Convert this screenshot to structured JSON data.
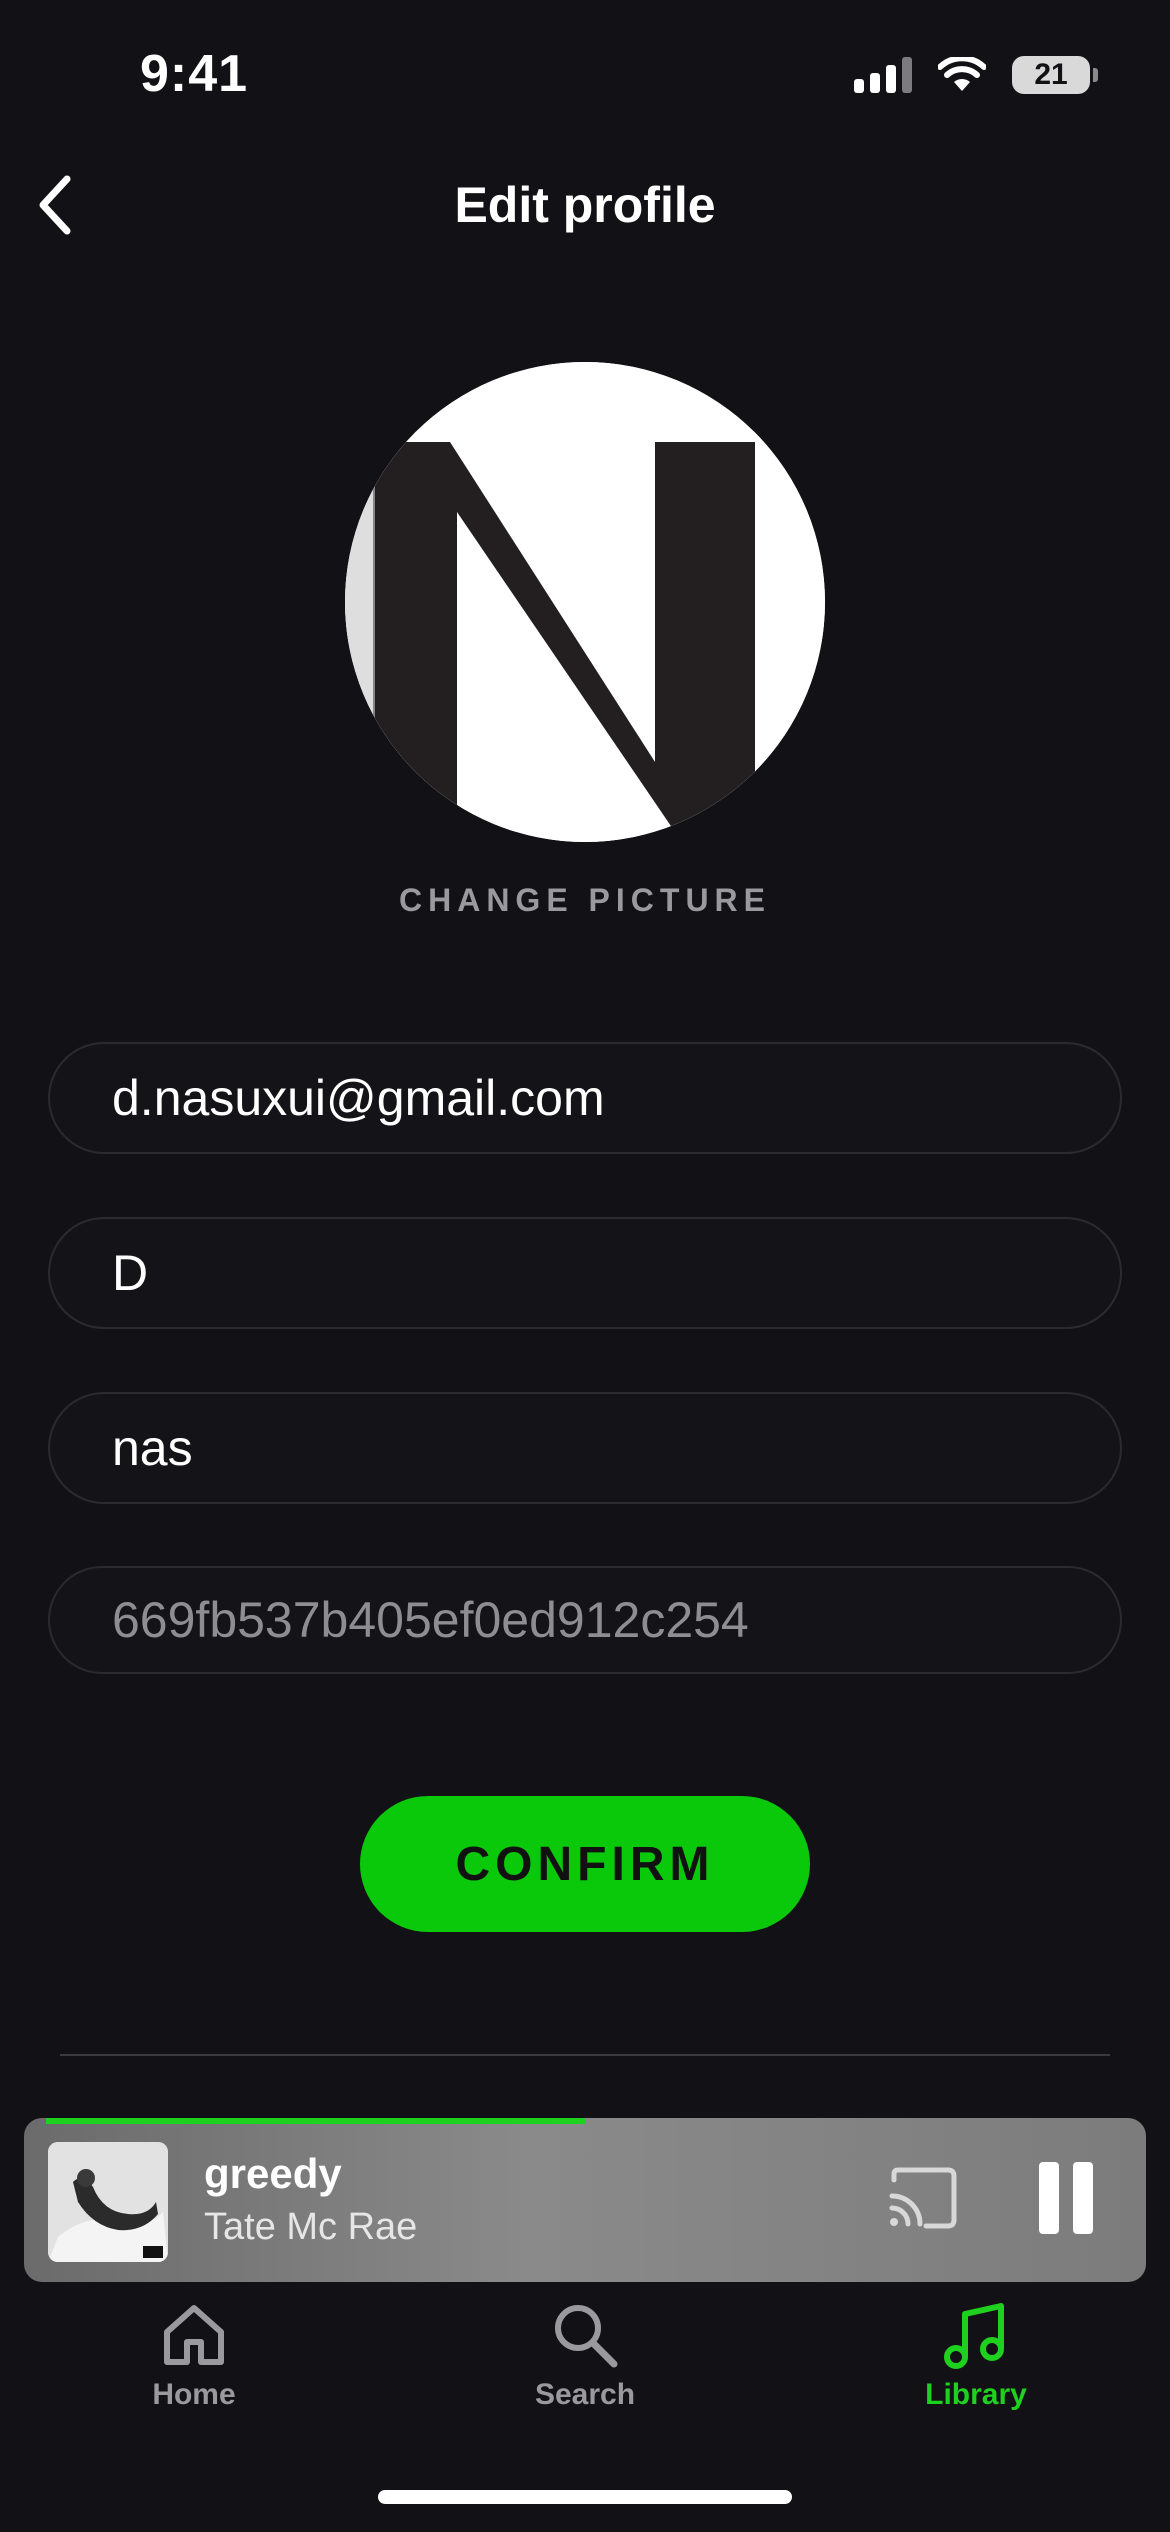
{
  "status_bar": {
    "time": "9:41",
    "battery_level": "21",
    "icons": [
      "signal-icon",
      "wifi-icon",
      "battery-icon"
    ]
  },
  "header": {
    "title": "Edit profile",
    "back_icon": "chevron-left-icon"
  },
  "avatar": {
    "initial": "N",
    "change_picture_label": "CHANGE PICTURE"
  },
  "form": {
    "email": "d.nasuxui@gmail.com",
    "first_name": "D",
    "last_name": "nas",
    "user_id": "669fb537b405ef0ed912c254",
    "confirm_label": "CONFIRM"
  },
  "mini_player": {
    "track_title": "greedy",
    "artist": "Tate Mc Rae",
    "progress": 0.5,
    "cast_icon": "cast-icon",
    "pause_icon": "pause-icon"
  },
  "tab_bar": {
    "tabs": [
      {
        "label": "Home",
        "icon": "home-icon",
        "active": false
      },
      {
        "label": "Search",
        "icon": "search-icon",
        "active": false
      },
      {
        "label": "Library",
        "icon": "music-note-icon",
        "active": true
      }
    ]
  },
  "colors": {
    "background": "#121216",
    "accent": "#0ac80a",
    "active_tab": "#1ed11e",
    "muted_text": "#9a9a9e"
  }
}
